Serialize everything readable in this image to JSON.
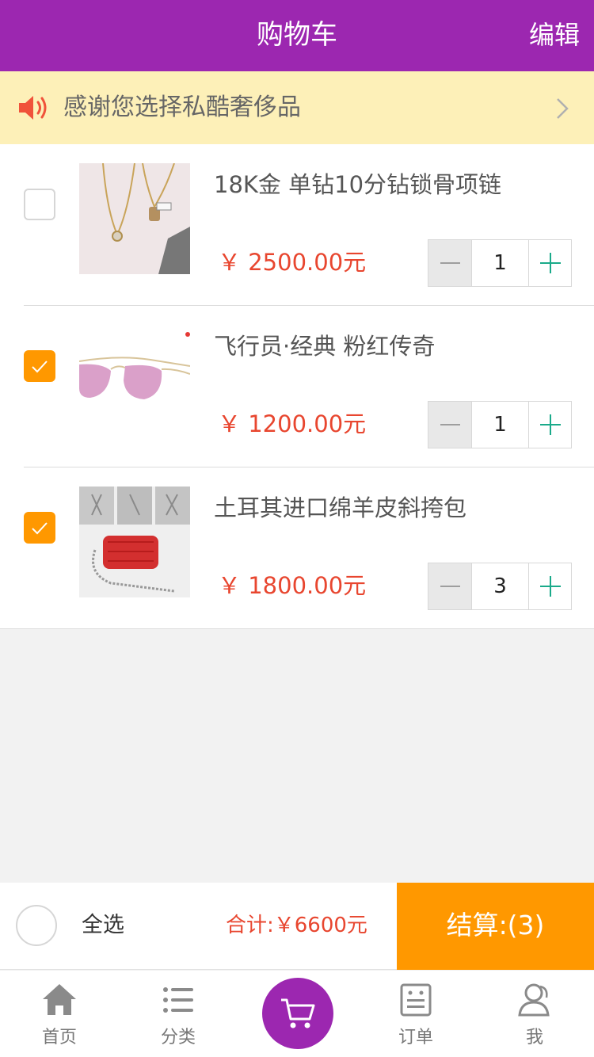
{
  "header": {
    "title": "购物车",
    "edit_label": "编辑"
  },
  "notice": {
    "text": "感谢您选择私酷奢侈品"
  },
  "items": [
    {
      "name": "18K金 单钻10分钻锁骨项链",
      "price": "￥ 2500.00元",
      "quantity": "1",
      "checked": false,
      "image": "necklace-image"
    },
    {
      "name": "飞行员·经典 粉红传奇",
      "price": "￥ 1200.00元",
      "quantity": "1",
      "checked": true,
      "image": "sunglasses-image"
    },
    {
      "name": "土耳其进口绵羊皮斜挎包",
      "price": "￥ 1800.00元",
      "quantity": "3",
      "checked": true,
      "image": "red-bag-image"
    }
  ],
  "footer": {
    "select_all_label": "全选",
    "total": "合计:￥6600元",
    "checkout": "结算:(3)"
  },
  "tabbar": {
    "tabs": [
      {
        "label": "首页",
        "icon": "home-icon"
      },
      {
        "label": "分类",
        "icon": "list-icon"
      },
      {
        "label": "",
        "icon": "cart-icon"
      },
      {
        "label": "订单",
        "icon": "order-icon"
      },
      {
        "label": "我",
        "icon": "user-icon"
      }
    ]
  },
  "colors": {
    "brand": "#9c27b0",
    "accent": "#ff9800",
    "price": "#e8462f",
    "plus": "#1aaa8a",
    "notice_bg": "#fdf0b8"
  }
}
